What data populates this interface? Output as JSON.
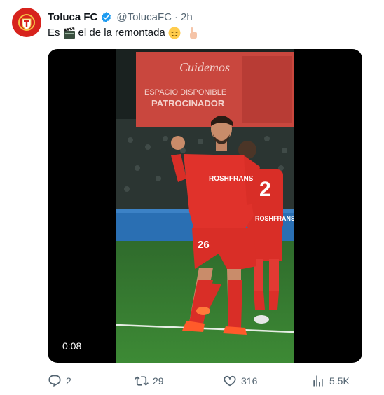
{
  "account": {
    "display_name": "Toluca FC",
    "handle": "@TolucaFC",
    "separator": "·",
    "time": "2h",
    "avatar_icon": "toluca-crest-icon",
    "verified_icon": "verified-badge-icon"
  },
  "tweet": {
    "text_before": "Es",
    "text_after": "el de la remontada",
    "emojis": [
      "clapper-board-icon",
      "relieved-face-icon",
      "pointing-finger-icon"
    ]
  },
  "media": {
    "duration": "0:08",
    "billboard_text_1": "Cuidemos",
    "billboard_text_2": "ESPACIO DISPONIBLE",
    "billboard_text_3": "PATROCINADOR",
    "shirt_text_1": "ROSHFRANS",
    "shirt_text_2": "ROSHFRANS",
    "player_number_1": "26",
    "player_number_2": "2"
  },
  "actions": {
    "replies": "2",
    "retweets": "29",
    "likes": "316",
    "views": "5.5K"
  },
  "colors": {
    "brand_red": "#d7231d",
    "verified_blue": "#1d9bf0",
    "text_secondary": "#536471"
  }
}
